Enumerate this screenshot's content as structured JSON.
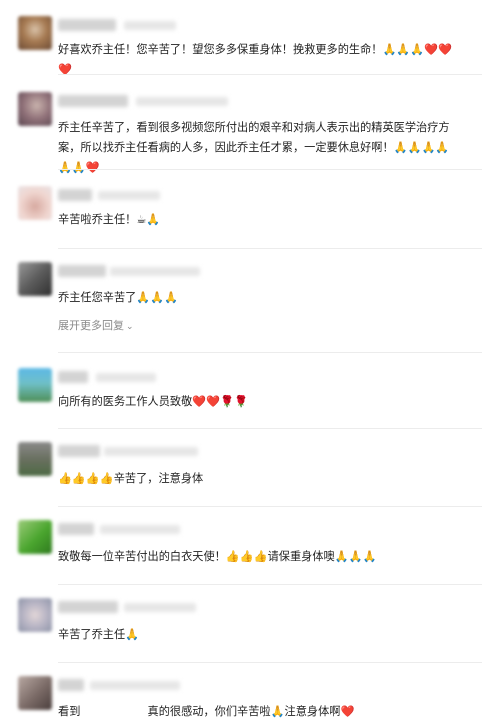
{
  "comments": [
    {
      "text": "好喜欢乔主任！您辛苦了！望您多多保重身体！挽救更多的生命！🙏🙏🙏❤️❤️❤️"
    },
    {
      "text": "乔主任辛苦了，看到很多视频您所付出的艰辛和对病人表示出的精英医学治疗方案，所以找乔主任看病的人多，因此乔主任才累，一定要休息好啊！🙏🙏🙏🙏🙏🙏❤️"
    },
    {
      "text": "辛苦啦乔主任！☕🙏"
    },
    {
      "text": "乔主任您辛苦了🙏🙏🙏",
      "more_label": "展开更多回复"
    },
    {
      "text": "向所有的医务工作人员致敬❤️❤️🌹🌹"
    },
    {
      "text": "👍👍👍👍辛苦了，注意身体"
    },
    {
      "text": "致敬每一位辛苦付出的白衣天使！👍👍👍请保重身体噢🙏🙏🙏"
    },
    {
      "text": "辛苦了乔主任🙏"
    },
    {
      "text_prefix": "看到",
      "text": "真的很感动，你们辛苦啦🙏注意身体啊❤️"
    }
  ],
  "colors": {
    "text": "#222222",
    "secondary": "#8a8a8a",
    "divider": "#ececec",
    "placeholder": "#d3d3d3"
  }
}
